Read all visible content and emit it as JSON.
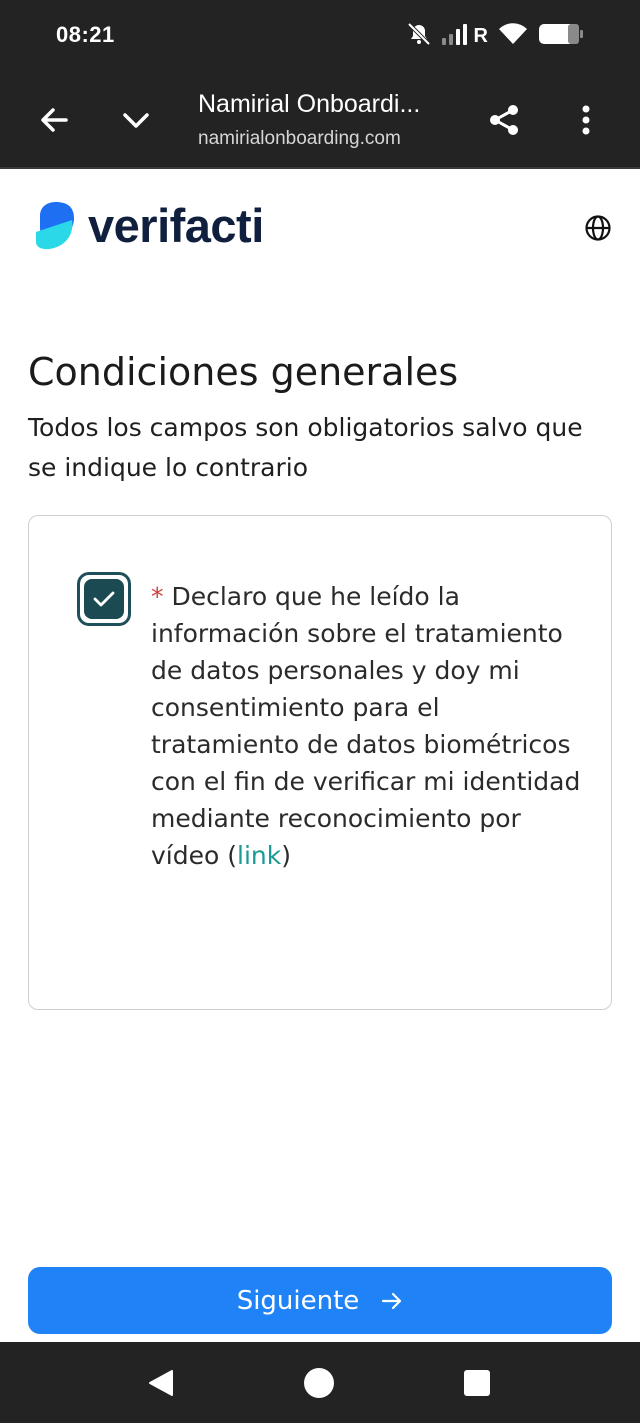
{
  "status_bar": {
    "time": "08:21",
    "network_label": "R",
    "icons": [
      "mute-icon",
      "signal-icon",
      "wifi-icon",
      "battery-icon"
    ]
  },
  "browser": {
    "title": "Namirial Onboardi...",
    "url": "namirialonboarding.com",
    "icons": [
      "back-arrow-icon",
      "chevron-down-icon",
      "share-icon",
      "more-vert-icon"
    ]
  },
  "brand": {
    "name": "verifacti",
    "colors": {
      "mark_top": "#1e6ff2",
      "mark_bottom": "#2ad8e8",
      "text": "#0f1f3d"
    }
  },
  "page": {
    "title": "Condiciones generales",
    "subtitle": "Todos los campos son obligatorios salvo que se indique lo contrario"
  },
  "consent": {
    "checked": true,
    "required_mark": "*",
    "text": " Declaro que he leído la información sobre el tratamiento de datos personales y doy mi consentimiento para el tratamiento de datos biométricos con el fin de verificar mi identidad mediante reconocimiento por vídeo (",
    "link_label": "link",
    "text_end": ")"
  },
  "actions": {
    "next_label": "Siguiente",
    "accent": "#1f82f7"
  },
  "system_nav": {
    "icons": [
      "back-triangle-icon",
      "home-circle-icon",
      "recents-square-icon"
    ]
  }
}
